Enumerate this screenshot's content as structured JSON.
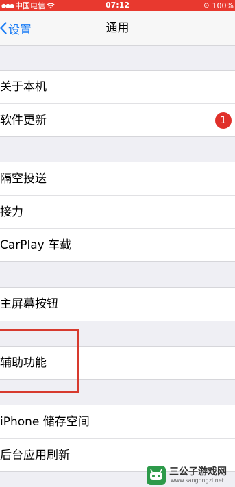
{
  "status_bar": {
    "carrier": "中国电信",
    "time": "07:12",
    "battery": "100%"
  },
  "nav": {
    "back_label": "设置",
    "title": "通用"
  },
  "groups": [
    {
      "rows": [
        {
          "label": "关于本机"
        },
        {
          "label": "软件更新",
          "badge": "1"
        }
      ]
    },
    {
      "rows": [
        {
          "label": "隔空投送"
        },
        {
          "label": "接力"
        },
        {
          "label": "CarPlay 车载"
        }
      ]
    },
    {
      "rows": [
        {
          "label": "主屏幕按钮"
        }
      ]
    },
    {
      "rows": [
        {
          "label": "辅助功能"
        }
      ]
    },
    {
      "rows": [
        {
          "label": "iPhone 储存空间"
        },
        {
          "label": "后台应用刷新"
        }
      ]
    }
  ],
  "watermark": {
    "title": "三公子游戏网",
    "url": "www.sangongzi.net"
  },
  "colors": {
    "status_bar": "#e8392f",
    "accent": "#1a7cf5",
    "badge": "#e0302a",
    "highlight": "#d73a2e"
  }
}
